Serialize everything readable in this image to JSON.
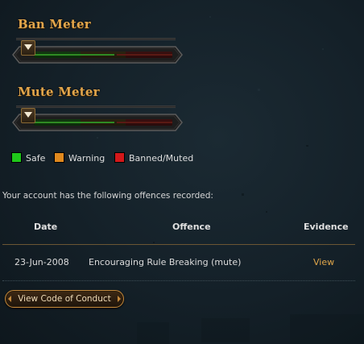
{
  "ban_meter": {
    "title": "Ban Meter",
    "level": 0.0
  },
  "mute_meter": {
    "title": "Mute Meter",
    "level": 0.0
  },
  "legend": [
    {
      "label": "Safe",
      "color": "#1fc81a"
    },
    {
      "label": "Warning",
      "color": "#e0891e"
    },
    {
      "label": "Banned/Muted",
      "color": "#d4181a"
    }
  ],
  "intro_text": "Your account has the following offences recorded:",
  "table": {
    "headers": {
      "date": "Date",
      "offence": "Offence",
      "evidence": "Evidence"
    },
    "rows": [
      {
        "date": "23-Jun-2008",
        "offence": "Encouraging Rule Breaking (mute)",
        "evidence": "View"
      }
    ]
  },
  "code_of_conduct_button": "View Code of Conduct",
  "colors": {
    "accent": "#e2a64c",
    "background": "#142028"
  }
}
